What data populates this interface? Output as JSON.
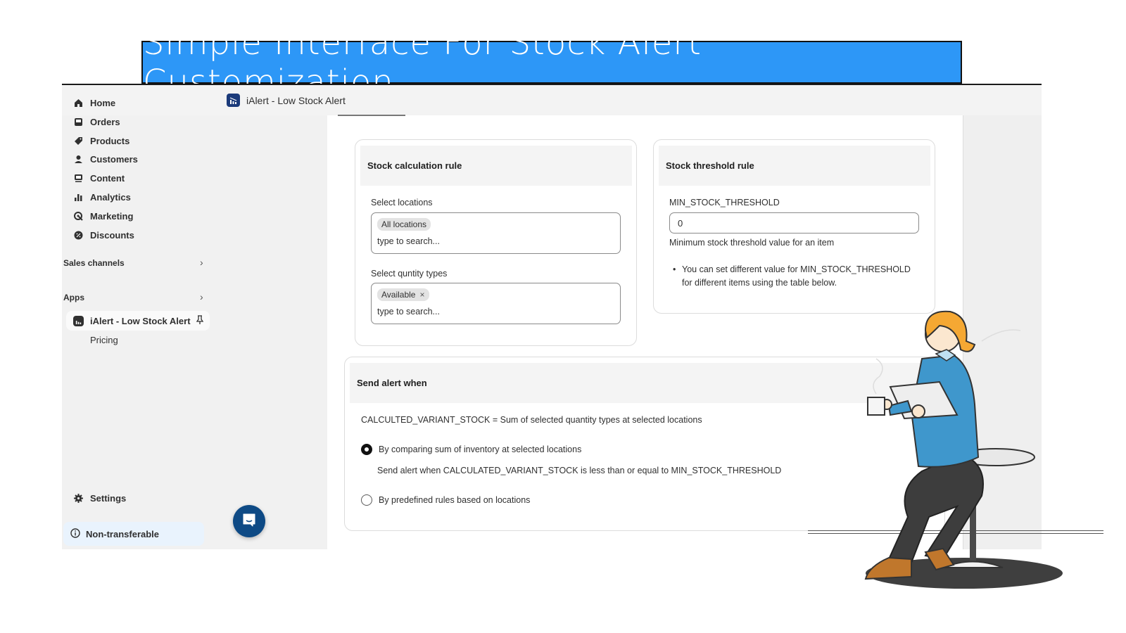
{
  "banner": {
    "title": "Simple Interface For Stock Alert Customization",
    "color": "#2d97f7"
  },
  "topbar": {
    "app_title": "iAlert - Low Stock Alert"
  },
  "sidebar": {
    "items": [
      {
        "label": "Home",
        "icon": "home-icon"
      },
      {
        "label": "Orders",
        "icon": "inbox-icon"
      },
      {
        "label": "Products",
        "icon": "tag-icon"
      },
      {
        "label": "Customers",
        "icon": "person-icon"
      },
      {
        "label": "Content",
        "icon": "image-icon"
      },
      {
        "label": "Analytics",
        "icon": "bar-chart-icon"
      },
      {
        "label": "Marketing",
        "icon": "target-icon"
      },
      {
        "label": "Discounts",
        "icon": "discount-icon"
      }
    ],
    "sales_channels": "Sales channels",
    "apps": "Apps",
    "app_item": "iAlert - Low Stock Alert",
    "app_sub_item": "Pricing",
    "settings": "Settings",
    "non_transferable": "Non-transferable"
  },
  "stock_calc": {
    "title": "Stock calculation rule",
    "locations_label": "Select locations",
    "locations_chip": "All locations",
    "locations_placeholder": "type to search...",
    "qty_label": "Select quntity types",
    "qty_chip": "Available",
    "qty_placeholder": "type to search..."
  },
  "threshold": {
    "title": "Stock threshold rule",
    "field_label": "MIN_STOCK_THRESHOLD",
    "value": "0",
    "help": "Minimum stock threshold value for an item",
    "bullet": "You can set different value for MIN_STOCK_THRESHOLD for different items using the table below."
  },
  "send_alert": {
    "title": "Send alert when",
    "formula": "CALCULTED_VARIANT_STOCK = Sum of selected quantity types at selected locations",
    "option1": "By comparing sum of inventory at selected locations",
    "option1_desc": "Send alert when CALCULATED_VARIANT_STOCK is less than or equal to MIN_STOCK_THRESHOLD",
    "option1_selected": true,
    "option2": "By predefined rules based on locations",
    "option2_selected": false
  }
}
